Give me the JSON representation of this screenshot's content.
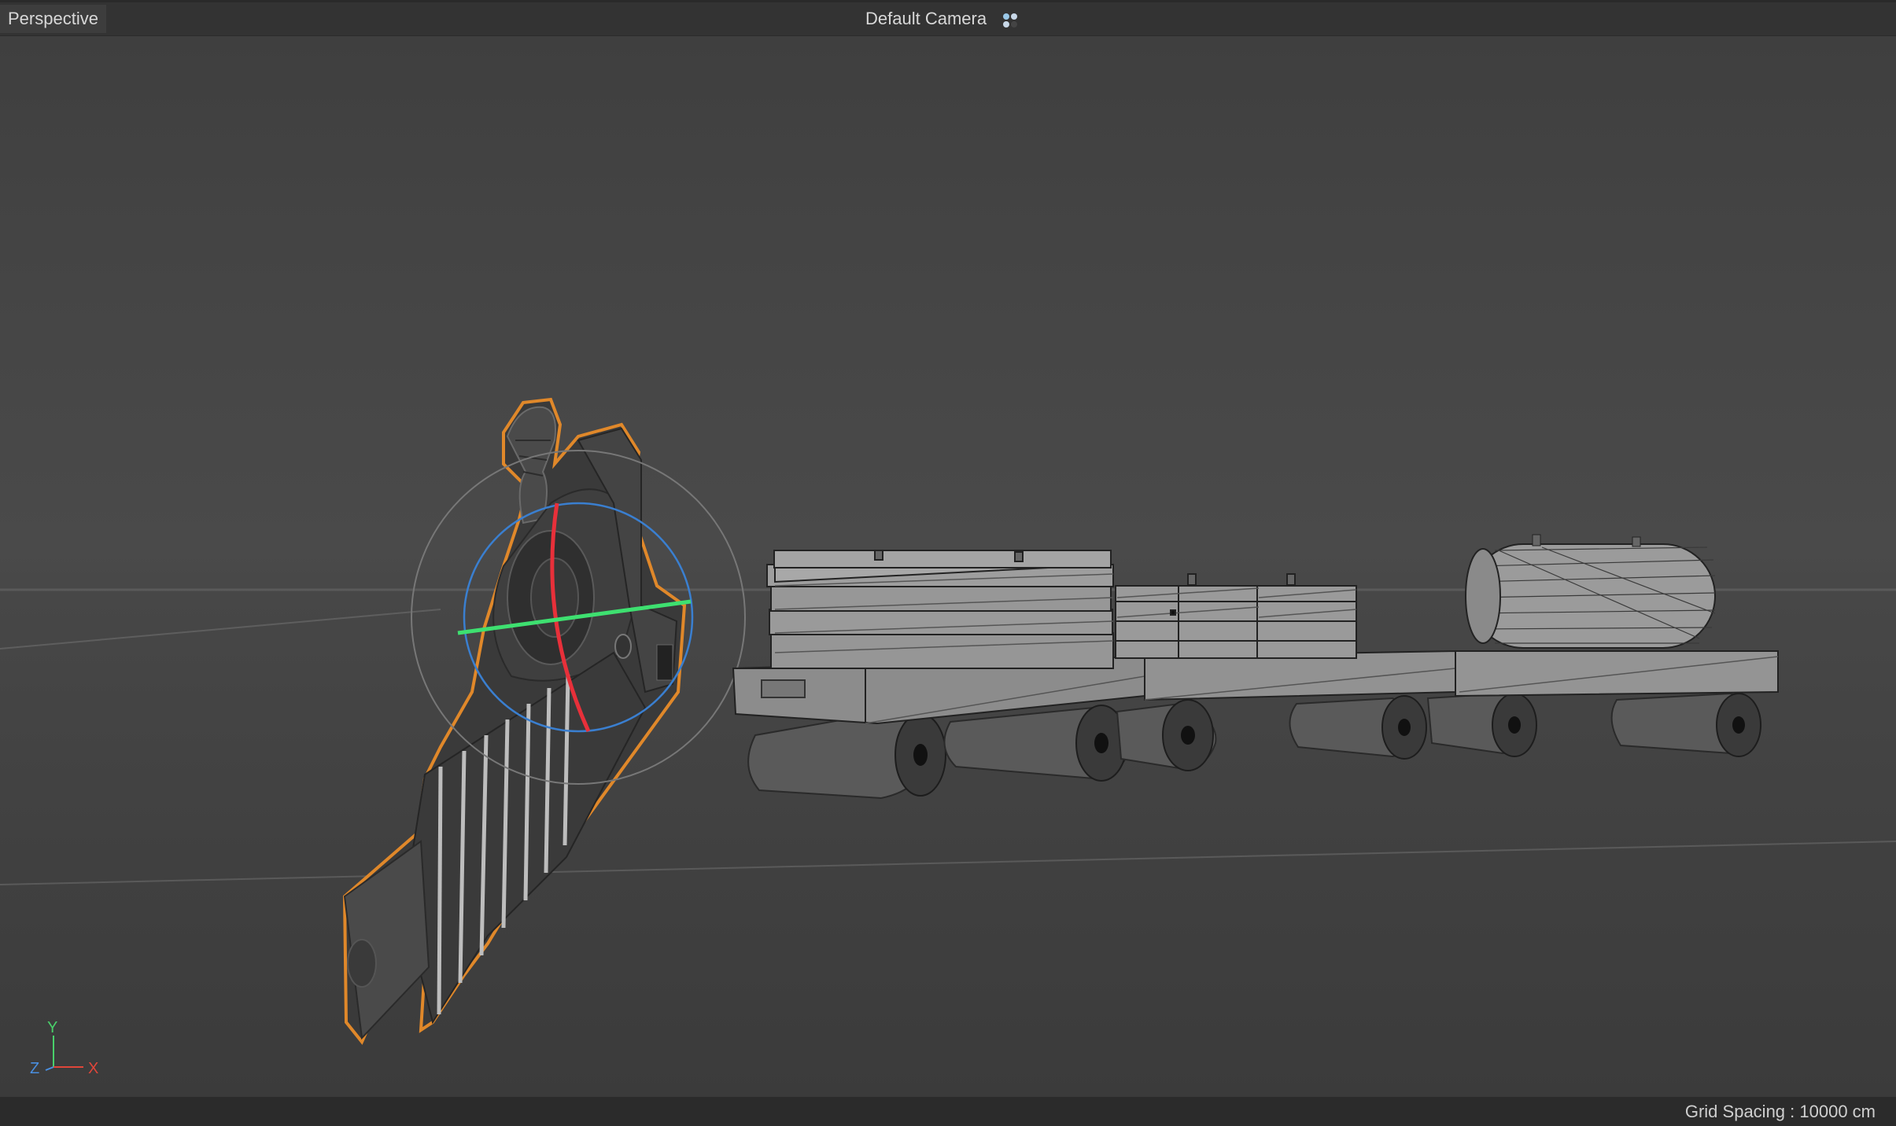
{
  "viewport": {
    "view_name": "Perspective",
    "camera_name": "Default Camera",
    "camera_icon": "camera-dots-icon",
    "grid_spacing": "Grid Spacing : 10000 cm"
  },
  "axis_gizmo": {
    "y_label": "Y",
    "z_label": "Z",
    "x_label": "X",
    "colors": {
      "x": "#e0463a",
      "y": "#49d06a",
      "z": "#4a8fe0"
    }
  },
  "scene": {
    "selected_object": "locomotive",
    "selection_color": "#e0882a",
    "gizmo_colors": {
      "x": "#e8303a",
      "y": "#3ee070",
      "z": "#3a7fd0"
    },
    "objects": [
      "locomotive",
      "flatcar-with-crates",
      "flatcar-with-small-crates",
      "flatcar-with-tank"
    ]
  }
}
